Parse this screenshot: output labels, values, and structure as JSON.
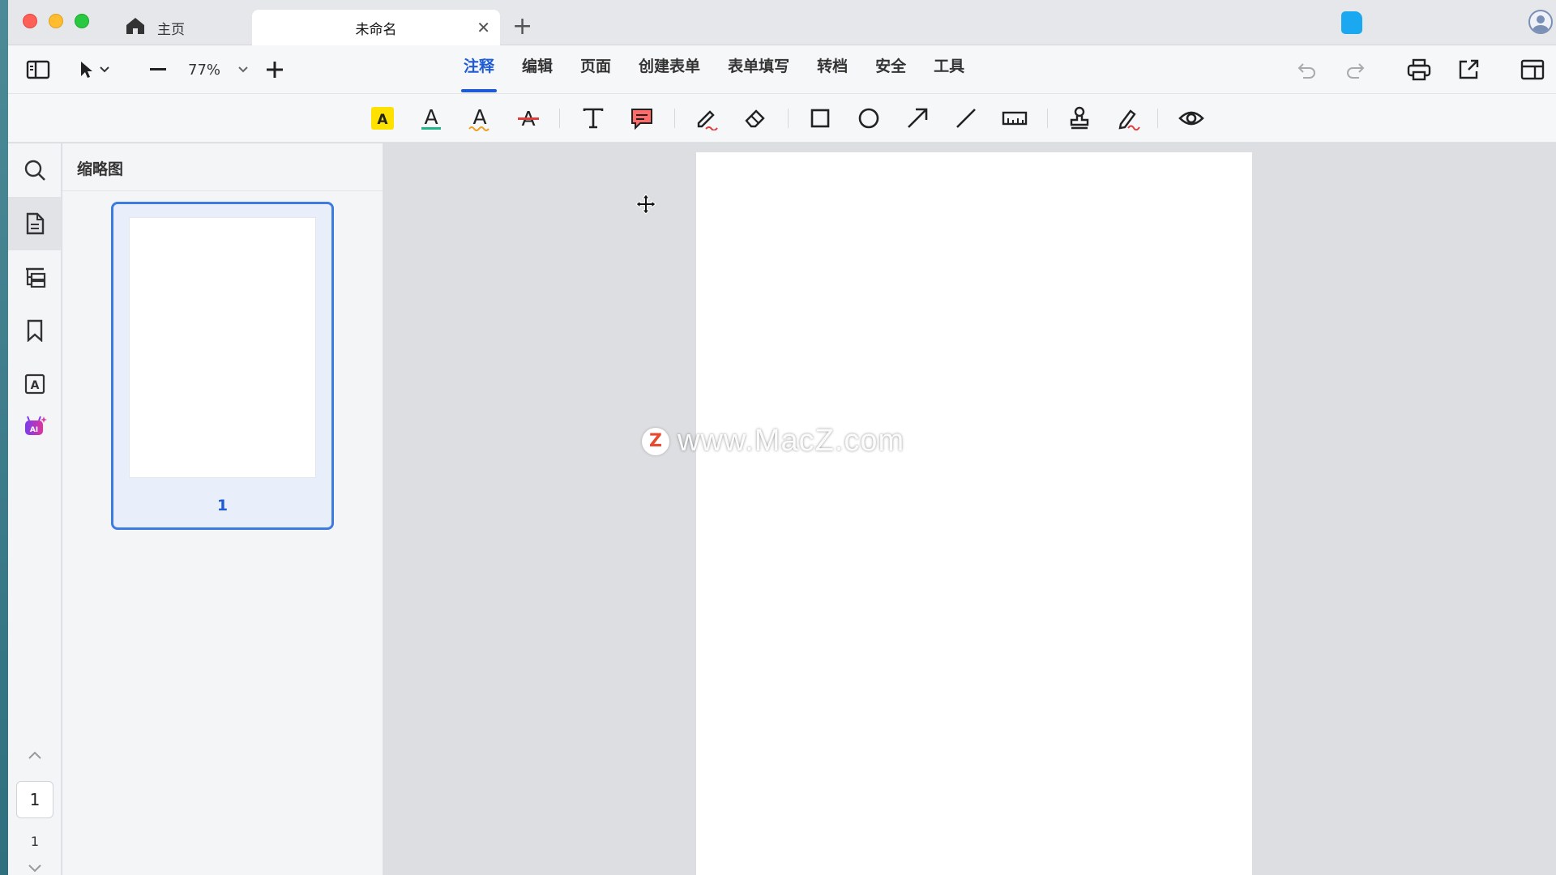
{
  "tabs": {
    "home_label": "主页",
    "doc_label": "未命名",
    "close_symbol": "✕",
    "add_symbol": "+"
  },
  "toolbar": {
    "zoom_value": "77%",
    "menu": [
      {
        "label": "注释",
        "active": true
      },
      {
        "label": "编辑"
      },
      {
        "label": "页面"
      },
      {
        "label": "创建表单"
      },
      {
        "label": "表单填写"
      },
      {
        "label": "转档"
      },
      {
        "label": "安全"
      },
      {
        "label": "工具"
      }
    ]
  },
  "annotation_tools": [
    "highlight-text",
    "underline-text",
    "squiggly-text",
    "strikethrough-text",
    "text-box",
    "comment",
    "pencil",
    "eraser",
    "rectangle",
    "ellipse",
    "arrow",
    "line",
    "measure",
    "stamp",
    "signature",
    "visibility"
  ],
  "sidebar": {
    "thumbnails_title": "缩略图",
    "thumbnail_page_number": "1",
    "current_page": "1",
    "total_pages": "1"
  },
  "watermark": {
    "logo_letter": "Z",
    "text": "www.MacZ.com"
  },
  "colors": {
    "accent": "#1f5bd6",
    "highlight_yellow": "#ffe100",
    "underline_green": "#1fb589",
    "squiggly_orange": "#f0a020",
    "strike_red": "#e33a3a",
    "comment_red": "#ff6a6a"
  }
}
